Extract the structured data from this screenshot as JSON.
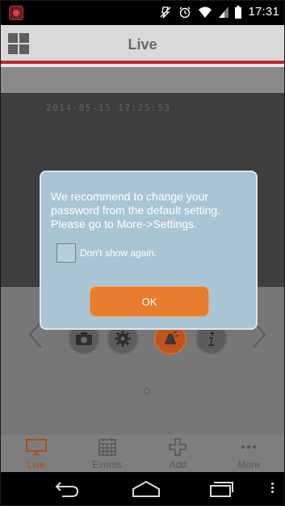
{
  "status_bar": {
    "time": "17:31",
    "icons": [
      "app-notification-icon",
      "mute-icon",
      "alarm-icon",
      "wifi-icon",
      "signal-icon",
      "battery-icon"
    ]
  },
  "header": {
    "title": "Live",
    "menu_icon": "grid-icon",
    "accent_color": "#c0282d"
  },
  "video": {
    "timestamp": "2014-05-15 17:25:53"
  },
  "controls": {
    "items": [
      "camera-icon",
      "gear-icon",
      "siren-icon",
      "info-icon"
    ],
    "prev_icon": "chevron-left-icon",
    "next_icon": "chevron-right-icon"
  },
  "tabs": [
    {
      "label": "Live",
      "icon": "monitor-icon",
      "active": true
    },
    {
      "label": "Events",
      "icon": "calendar-icon",
      "active": false
    },
    {
      "label": "Add",
      "icon": "plus-icon",
      "active": false
    },
    {
      "label": "More",
      "icon": "more-icon",
      "active": false
    }
  ],
  "dialog": {
    "message": "We recommend to change your password from the default setting. Please go to More->Settings.",
    "checkbox_label": "Don't show again.",
    "checkbox_checked": false,
    "ok_label": "OK",
    "button_color": "#e87d2d"
  },
  "nav_bar": {
    "icons": [
      "back-icon",
      "home-icon",
      "recent-apps-icon",
      "menu-icon"
    ]
  }
}
